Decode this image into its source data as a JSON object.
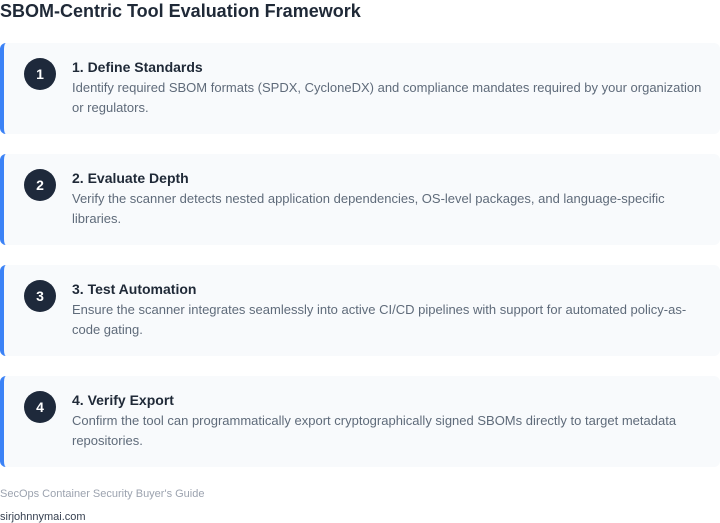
{
  "title": "SBOM-Centric Tool Evaluation Framework",
  "accent_color": "#3b82f6",
  "badge_color": "#1e293b",
  "steps": [
    {
      "number": "1",
      "title": "1. Define Standards",
      "description": "Identify required SBOM formats (SPDX, CycloneDX) and compliance mandates required by your organization or regulators."
    },
    {
      "number": "2",
      "title": "2. Evaluate Depth",
      "description": "Verify the scanner detects nested application dependencies, OS-level packages, and language-specific libraries."
    },
    {
      "number": "3",
      "title": "3. Test Automation",
      "description": "Ensure the scanner integrates seamlessly into active CI/CD pipelines with support for automated policy-as-code gating."
    },
    {
      "number": "4",
      "title": "4. Verify Export",
      "description": "Confirm the tool can programmatically export cryptographically signed SBOMs directly to target metadata repositories."
    }
  ],
  "footer": {
    "guide": "SecOps Container Security Buyer's Guide",
    "site": "sirjohnnymai.com"
  }
}
